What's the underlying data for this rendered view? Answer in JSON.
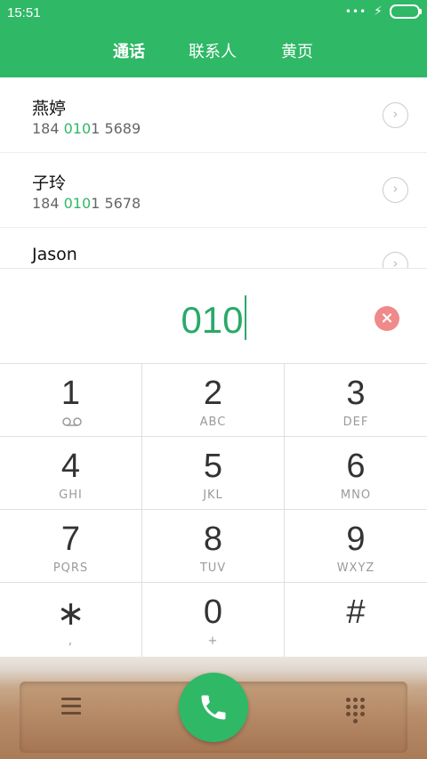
{
  "status": {
    "time": "15:51"
  },
  "tabs": [
    {
      "label": "通话",
      "active": true
    },
    {
      "label": "联系人",
      "active": false
    },
    {
      "label": "黄页",
      "active": false
    }
  ],
  "contacts": [
    {
      "name": "燕婷",
      "num_pre": "184 ",
      "num_hl": "010",
      "num_post": "1 5689"
    },
    {
      "name": "子玲",
      "num_pre": "184 ",
      "num_hl": "010",
      "num_post": "1 5678"
    },
    {
      "name": "Jason",
      "num_pre": "",
      "num_hl": "",
      "num_post": ""
    }
  ],
  "input": {
    "value": "010"
  },
  "keypad": [
    {
      "num": "1",
      "sub": ""
    },
    {
      "num": "2",
      "sub": "ABC"
    },
    {
      "num": "3",
      "sub": "DEF"
    },
    {
      "num": "4",
      "sub": "GHI"
    },
    {
      "num": "5",
      "sub": "JKL"
    },
    {
      "num": "6",
      "sub": "MNO"
    },
    {
      "num": "7",
      "sub": "PQRS"
    },
    {
      "num": "8",
      "sub": "TUV"
    },
    {
      "num": "9",
      "sub": "WXYZ"
    },
    {
      "num": "∗",
      "sub": ","
    },
    {
      "num": "0",
      "sub": "+"
    },
    {
      "num": "#",
      "sub": ""
    }
  ],
  "colors": {
    "accent": "#2fb866",
    "highlight": "#2aa969",
    "clear": "#f08a8a"
  },
  "icons": {
    "voicemail": "voicemail-icon",
    "clear": "clear-input-icon",
    "call": "phone-icon",
    "menu": "menu-icon",
    "dialpad": "dialpad-icon"
  }
}
